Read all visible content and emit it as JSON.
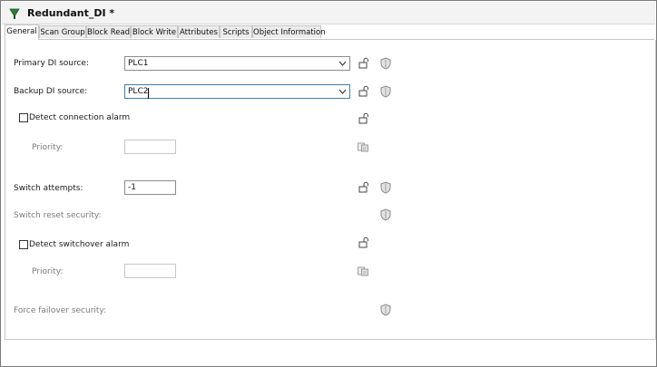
{
  "window": {
    "title": "Redundant_DI *"
  },
  "tabs": [
    {
      "label": "General",
      "active": true
    },
    {
      "label": "Scan Group"
    },
    {
      "label": "Block Read"
    },
    {
      "label": "Block Write"
    },
    {
      "label": "Attributes"
    },
    {
      "label": "Scripts"
    },
    {
      "label": "Object Information"
    }
  ],
  "general": {
    "primary_di_source": {
      "label": "Primary DI source:",
      "value": "PLC1"
    },
    "backup_di_source": {
      "label": "Backup DI source:",
      "value": "PLC2"
    },
    "detect_connection_alarm": {
      "label": "Detect connection alarm",
      "checked": false
    },
    "connection_priority": {
      "label": "Priority:",
      "value": ""
    },
    "switch_attempts": {
      "label": "Switch attempts:",
      "value": "-1"
    },
    "switch_reset_security": {
      "label": "Switch reset security:"
    },
    "detect_switchover_alarm": {
      "label": "Detect switchover alarm",
      "checked": false
    },
    "switchover_priority": {
      "label": "Priority:",
      "value": ""
    },
    "force_failover_security": {
      "label": "Force failover security:"
    }
  },
  "icons": {
    "title": "galaxy-object-icon",
    "lock": "lock-icon",
    "security": "shield-icon",
    "priority": "alarm-priority-icon"
  },
  "colors": {
    "focus_border": "#3c7fb1",
    "disabled_text": "#7b7b7b"
  }
}
